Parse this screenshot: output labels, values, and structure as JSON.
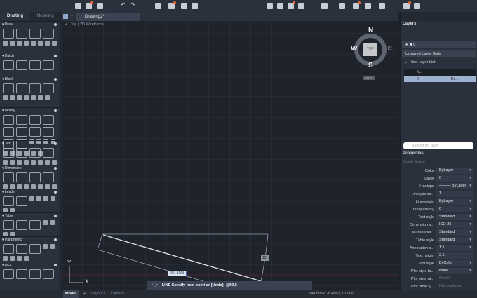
{
  "toolbar": {
    "icons": [
      "new-icon",
      "open-icon",
      "save-icon",
      "save-as-icon",
      "undo-icon",
      "redo-icon",
      "plot-icon",
      "publish-icon"
    ]
  },
  "left_palette": {
    "tabs": [
      "Drafting",
      "Modeling"
    ],
    "sections": [
      "Draw",
      "Hatch",
      "Block",
      "Modify",
      "Text",
      "Dimension",
      "Leader",
      "Table",
      "Parametric",
      "arcs"
    ]
  },
  "document": {
    "tab": "Drawing2*",
    "view": "Top",
    "visual_style": "2D Wireframe"
  },
  "viewcube": {
    "face": "TOP",
    "n": "N",
    "s": "S",
    "e": "E",
    "w": "W",
    "ucs": "WCS"
  },
  "canvas": {
    "dim_value": "207.3168",
    "angle_value": "15°",
    "ucs_x": "X",
    "ucs_y": "Y"
  },
  "command": {
    "prompt": "LINE Specify next point or [Undo]: @50,0"
  },
  "status": {
    "tabs": [
      "Model",
      "Layout1",
      "Layout2"
    ],
    "coords": "248.8952, -8.4893, 0.0000"
  },
  "layers": {
    "title": "Layers",
    "current": "0",
    "state": "Unsaved Layer State",
    "hide_list": "Hide Layer List",
    "col_name": "N...",
    "row_name": "0",
    "row_lt": "De...",
    "search_placeholder": "Search for layer"
  },
  "properties": {
    "title": "Properties",
    "space": "Model Space",
    "rows": [
      {
        "label": "Color",
        "value": "ByLayer",
        "dd": true
      },
      {
        "label": "Layer",
        "value": "0",
        "dd": true
      },
      {
        "label": "Linetype",
        "value": "——— ByLayer",
        "dd": true
      },
      {
        "label": "Linetype sc...",
        "value": "1",
        "dd": false
      },
      {
        "label": "Lineweight",
        "value": "ByLayer",
        "dd": true
      },
      {
        "label": "Transparency",
        "value": "0",
        "dd": true
      },
      {
        "label": "Text style",
        "value": "Standard",
        "dd": true
      },
      {
        "label": "Dimension s...",
        "value": "ISO-25",
        "dd": true
      },
      {
        "label": "Multileader...",
        "value": "Standard",
        "dd": true
      },
      {
        "label": "Table style",
        "value": "Standard",
        "dd": true
      },
      {
        "label": "Annotation s...",
        "value": "1:1",
        "dd": true
      },
      {
        "label": "Text height",
        "value": "2.5",
        "dd": false
      },
      {
        "label": "Plot style",
        "value": "ByColor",
        "dd": true
      },
      {
        "label": "Plot style ta...",
        "value": "None",
        "dd": true
      },
      {
        "label": "Plot style at...",
        "value": "Model",
        "dd": false,
        "dim": true
      },
      {
        "label": "Plot table ty...",
        "value": "Not available",
        "dd": false,
        "dim": true
      }
    ]
  },
  "colors": {
    "accent": "#e8663d",
    "panel": "#2b313c",
    "canvas": "#1f232c"
  }
}
